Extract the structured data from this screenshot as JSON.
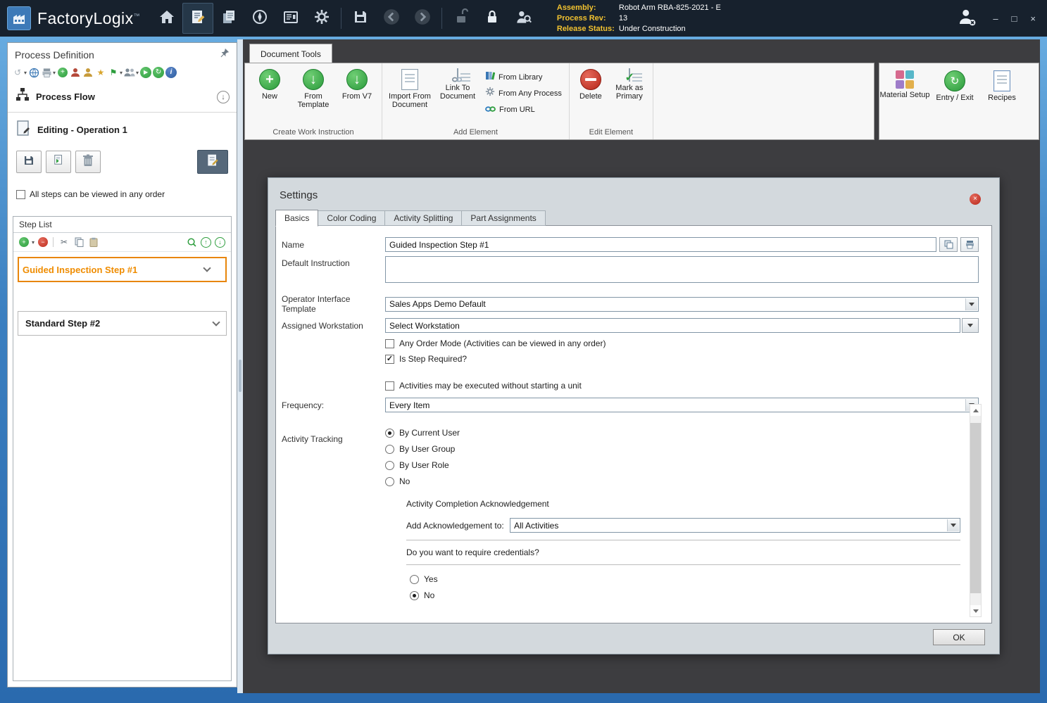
{
  "theme": {
    "titlebar_bg": "#17212d",
    "accent_orange": "#ef8c00",
    "label_gold": "#f2c230",
    "green": "#2e9e3e",
    "red": "#bf2e1f",
    "main_bg": "#3d3d40",
    "dialog_bg": "#d3d9dd"
  },
  "glyphs": {
    "dropdown": "▾",
    "plus": "+",
    "minus": "−",
    "down_arrow": "↓",
    "up_arrow": "↑",
    "check": "✓",
    "cross": "×",
    "star": "★",
    "flag": "⚑",
    "scissors": "✂",
    "undo": "↺",
    "redo": "↻",
    "play": "▶",
    "record": "●",
    "info": "i",
    "minimize": "–",
    "maximize": "□",
    "close": "×"
  },
  "titlebar": {
    "app_name": "FactoryLogix",
    "trademark": "™",
    "info": {
      "assembly_label": "Assembly:",
      "assembly_value": "Robot Arm RBA-825-2021 - E",
      "process_rev_label": "Process Rev:",
      "process_rev_value": "13",
      "release_status_label": "Release Status:",
      "release_status_value": "Under Construction"
    }
  },
  "sidebar": {
    "title": "Process Definition",
    "process_flow": "Process Flow",
    "editing": "Editing - Operation 1",
    "all_steps_checkbox": "All steps can be viewed in any order",
    "step_list_title": "Step List",
    "steps": [
      {
        "label": "Guided Inspection Step #1"
      },
      {
        "label": "Standard Step #2"
      }
    ]
  },
  "ribbon": {
    "tab_label": "Document Tools",
    "create_group": {
      "title": "Create Work Instruction",
      "new": "New",
      "from_template": "From Template",
      "from_v7": "From V7"
    },
    "add_group": {
      "title": "Add Element",
      "import_from_document": "Import From Document",
      "link_to_document": "Link To Document",
      "from_library": "From Library",
      "from_any_process": "From Any Process",
      "from_url": "From URL"
    },
    "edit_group": {
      "title": "Edit Element",
      "delete": "Delete",
      "mark_as_primary": "Mark as Primary"
    },
    "right_group": {
      "material_setup": "Material Setup",
      "entry_exit": "Entry / Exit",
      "recipes": "Recipes"
    }
  },
  "dialog": {
    "title": "Settings",
    "tabs": [
      {
        "label": "Basics"
      },
      {
        "label": "Color Coding"
      },
      {
        "label": "Activity Splitting"
      },
      {
        "label": "Part Assignments"
      }
    ],
    "active_tab": "Basics",
    "name_label": "Name",
    "name_value": "Guided Inspection Step #1",
    "default_instruction_label": "Default Instruction",
    "default_instruction_value": "",
    "operator_template_label": "Operator Interface Template",
    "operator_template_value": "Sales Apps Demo Default",
    "workstation_label": "Assigned Workstation",
    "workstation_value": "Select Workstation",
    "any_order_checkbox": "Any Order Mode (Activities can be viewed in any order)",
    "required_checkbox": "Is Step Required?",
    "without_unit_checkbox": "Activities may be executed without starting a unit",
    "frequency_label": "Frequency:",
    "frequency_value": "Every Item",
    "tracking_label": "Activity Tracking",
    "tracking_options": [
      {
        "label": "By Current User",
        "selected": true
      },
      {
        "label": "By User Group",
        "selected": false
      },
      {
        "label": "By User Role",
        "selected": false
      },
      {
        "label": "No",
        "selected": false
      }
    ],
    "ack_section_title": "Activity Completion Acknowledgement",
    "ack_label": "Add Acknowledgement to:",
    "ack_value": "All Activities",
    "credentials_question": "Do you want to require credentials?",
    "credentials_options": [
      {
        "label": "Yes",
        "selected": false
      },
      {
        "label": "No",
        "selected": true
      }
    ],
    "ok_label": "OK"
  }
}
